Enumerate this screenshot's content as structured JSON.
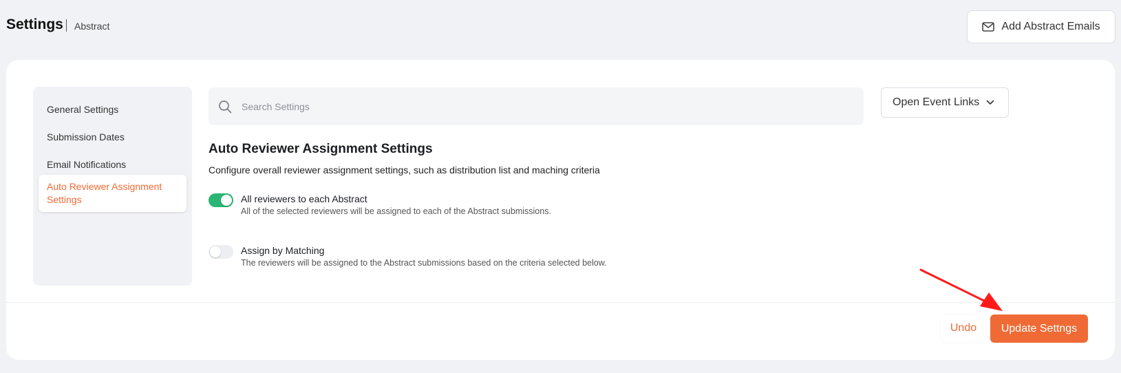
{
  "header": {
    "title": "Settings",
    "subtitle": "Abstract",
    "add_emails_label": "Add Abstract Emails",
    "add_emails_icon": "mail-icon"
  },
  "sidebar": {
    "items": [
      {
        "label": "General Settings",
        "active": false
      },
      {
        "label": "Submission Dates",
        "active": false
      },
      {
        "label": "Email Notifications",
        "active": false
      },
      {
        "label": "Auto Reviewer Assignment Settings",
        "active": true
      }
    ]
  },
  "search": {
    "placeholder": "Search Settings",
    "value": "",
    "icon": "search-icon"
  },
  "event_links": {
    "label": "Open Event Links",
    "icon": "chevron-down-icon"
  },
  "section": {
    "title": "Auto Reviewer Assignment Settings",
    "description": "Configure overall reviewer assignment settings, such as distribution list and maching criteria",
    "options": [
      {
        "label": "All reviewers to each Abstract",
        "description": "All of the selected reviewers will be assigned to each of the Abstract submissions.",
        "enabled": true
      },
      {
        "label": "Assign by Matching",
        "description": "The reviewers will be assigned to the Abstract submissions based on the criteria selected below.",
        "enabled": false
      }
    ]
  },
  "footer": {
    "undo_label": "Undo",
    "update_label": "Update Settngs"
  },
  "colors": {
    "accent": "#ef6a35",
    "toggle_on": "#2bb673",
    "annotation_arrow": "#ff1a1a"
  }
}
